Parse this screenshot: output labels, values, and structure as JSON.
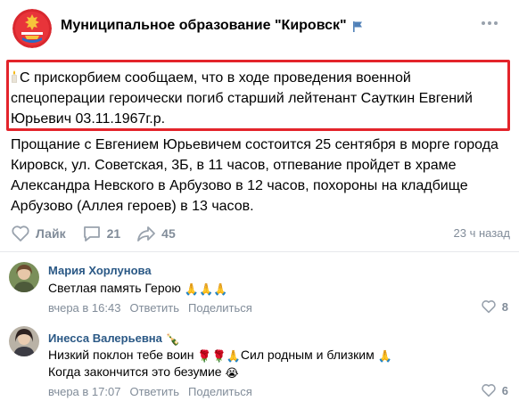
{
  "community": {
    "name": "Муниципальное образование \"Кировск\"",
    "verified_icon": "flag-icon"
  },
  "post": {
    "highlighted_text": "С прискорбием сообщаем, что в ходе проведения военной спецоперации героически погиб старший лейтенант Сауткин Евгений Юрьевич 03.11.1967г.р.",
    "body_text": "Прощание с Евгением Юрьевичем состоится 25 сентября в морге города Кировск, ул. Советская, 3Б, в 11 часов, отпевание пройдет в храме Александра Невского в Арбузово в 12 часов, похороны на кладбище Арбузово (Аллея героев) в 13 часов.",
    "like_label": "Лайк",
    "comments_count": "21",
    "shares_count": "45",
    "time": "23 ч назад"
  },
  "comments": [
    {
      "author": "Мария Хорлунова",
      "text": "Светлая память Герою",
      "emoji": "🙏🙏🙏",
      "time": "вчера в 16:43",
      "reply_label": "Ответить",
      "share_label": "Поделиться",
      "likes": "8"
    },
    {
      "author": "Инесса Валерьевна",
      "author_emoji": "🍾",
      "text_line1": "Низкий поклон тебе воин",
      "emoji_mid": "🌹🌹🙏",
      "text_line1_tail": "Сил родным и близким",
      "emoji_end": "🙏",
      "text_line2": "Когда закончится это безумие",
      "emoji_line2": "😭",
      "time": "вчера в 17:07",
      "reply_label": "Ответить",
      "share_label": "Поделиться",
      "likes": "6"
    }
  ],
  "colors": {
    "accent": "#2a5885",
    "muted": "#818c99",
    "highlight_border": "#e3242b",
    "verified": "#5181b8"
  }
}
